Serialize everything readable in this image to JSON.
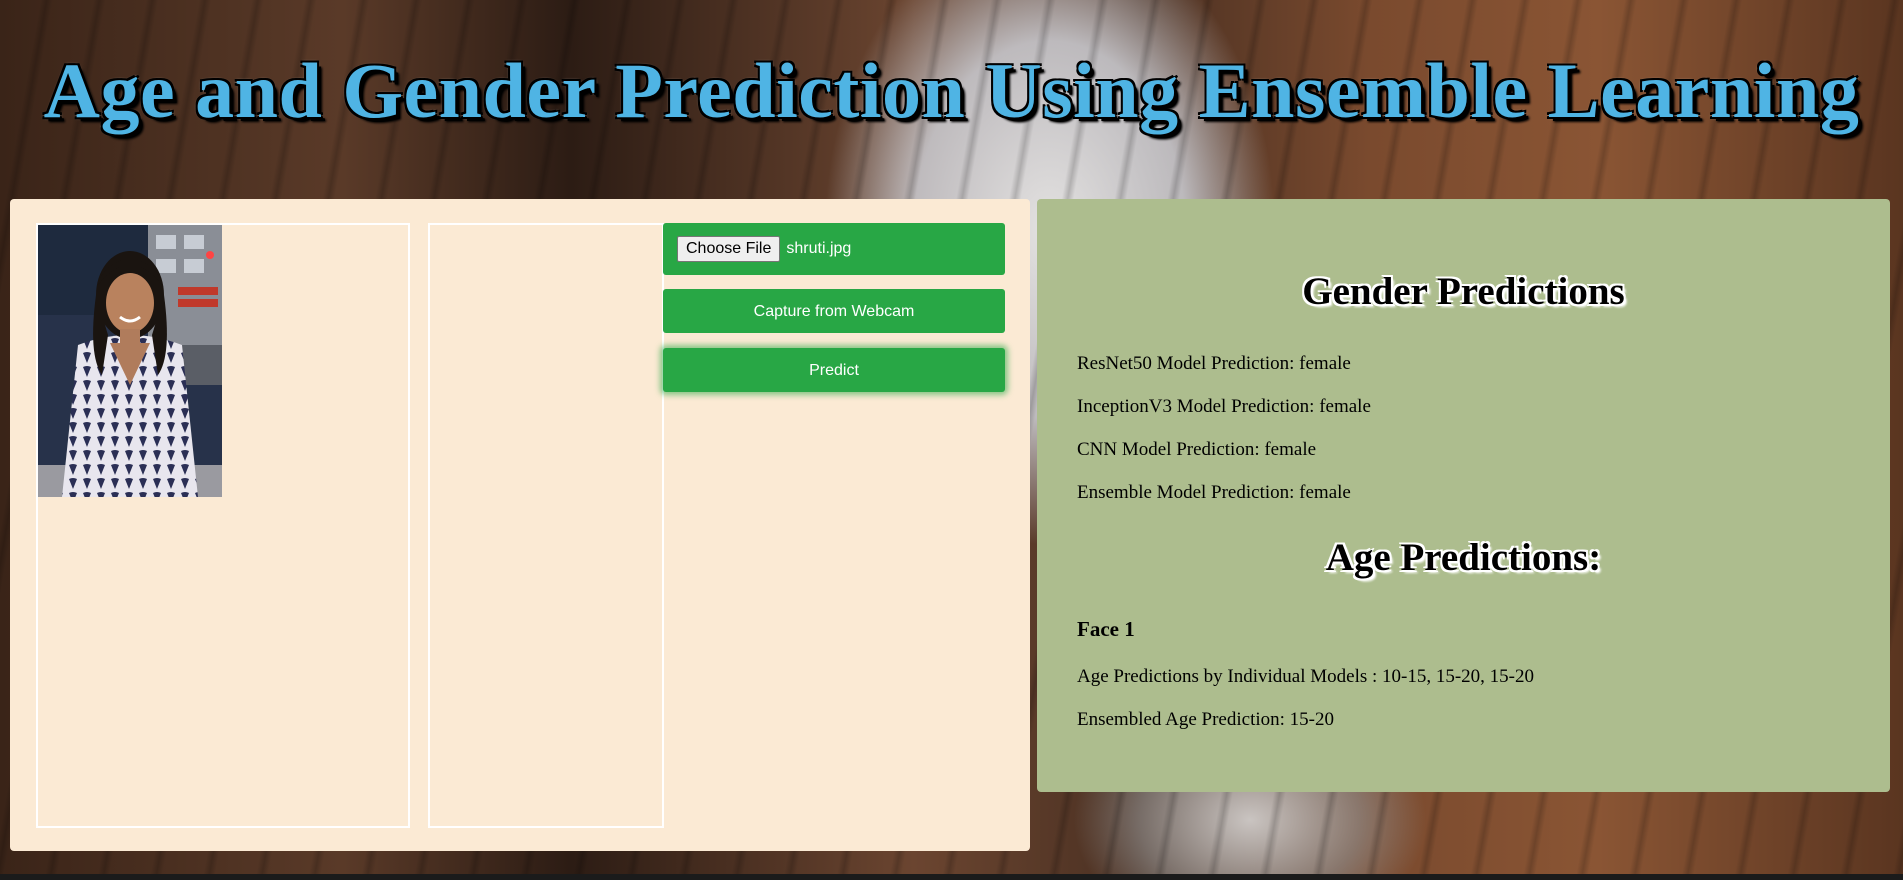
{
  "header": {
    "title": "Age and Gender Prediction Using Ensemble Learning"
  },
  "upload": {
    "choose_file_label": "Choose File",
    "file_name": "shruti.jpg",
    "capture_label": "Capture from Webcam",
    "predict_label": "Predict"
  },
  "gender": {
    "heading": "Gender Predictions",
    "lines": [
      "ResNet50 Model Prediction: female",
      "InceptionV3 Model Prediction: female",
      "CNN Model Prediction: female",
      "Ensemble Model Prediction: female"
    ]
  },
  "age": {
    "heading": "Age Predictions:",
    "faces": [
      {
        "label": "Face 1",
        "individual": "Age Predictions by Individual Models : 10-15, 15-20, 15-20",
        "ensembled": "Ensembled Age Prediction: 15-20"
      }
    ]
  },
  "colors": {
    "title_blue": "#4fb4e4",
    "button_green": "#28a745",
    "left_panel_bg": "#fbead4",
    "right_panel_bg": "#adbd8e"
  }
}
